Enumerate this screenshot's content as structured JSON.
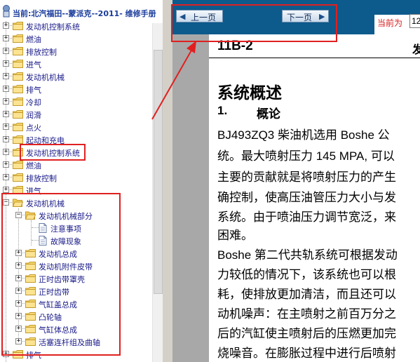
{
  "tree": {
    "title": "当前:北汽福田--蒙派克--2011- 维修手册",
    "items": [
      {
        "label": "发动机控制系统"
      },
      {
        "label": "燃油"
      },
      {
        "label": "排放控制"
      },
      {
        "label": "进气"
      },
      {
        "label": "发动机机械"
      },
      {
        "label": "排气"
      },
      {
        "label": "冷却"
      },
      {
        "label": "润滑"
      },
      {
        "label": "点火"
      },
      {
        "label": "起动和充电"
      },
      {
        "label": "发动机控制系统"
      },
      {
        "label": "燃油"
      },
      {
        "label": "排放控制"
      },
      {
        "label": "进气"
      },
      {
        "label": "发动机机械"
      },
      {
        "label": "发动机机械部分"
      },
      {
        "label": "注意事项"
      },
      {
        "label": "故障现象"
      },
      {
        "label": "发动机总成"
      },
      {
        "label": "发动机附件皮带"
      },
      {
        "label": "正时齿带罩壳"
      },
      {
        "label": "正时齿带"
      },
      {
        "label": "气缸盖总成"
      },
      {
        "label": "凸轮轴"
      },
      {
        "label": "气缸体总成"
      },
      {
        "label": "活塞连杆组及曲轴"
      },
      {
        "label": "排气"
      }
    ]
  },
  "nav": {
    "prev_label": "上一页",
    "next_label": "下一页",
    "page_label": "当前为",
    "page_value": "12"
  },
  "doc": {
    "code": "11B-2",
    "header_right": "发",
    "heading": "系统概述",
    "section_num": "1.",
    "section_title": "概论",
    "lines": [
      "BJ493ZQ3 柴油机选用 Boshe 公",
      "统。最大喷射压力 145 MPA, 可以",
      "主要的贡献就是将喷射压力的产生",
      "确控制，使高压油管压力大小与发",
      "系统。由于喷油压力调节宽泛，来",
      "困难。",
      "Boshe 第二代共轨系统可根据发动",
      "力较低的情况下，该系统也可以根",
      "耗，使排放更加清洁，而且还可以",
      "动机噪声：在主喷射之前百万分之",
      "后的汽缸使主喷射后的压燃更加完",
      "烧噪音。在膨胀过程中进行后喷射"
    ]
  },
  "colors": {
    "annotation": "#e02020",
    "navbar": "#0d5a8c",
    "tree_text": "#1a1a8a",
    "page_label": "#d81c1c"
  },
  "icons": {
    "folder": "folder-icon",
    "document": "document-icon",
    "expand": "plus-box-icon",
    "collapse": "minus-box-icon"
  }
}
